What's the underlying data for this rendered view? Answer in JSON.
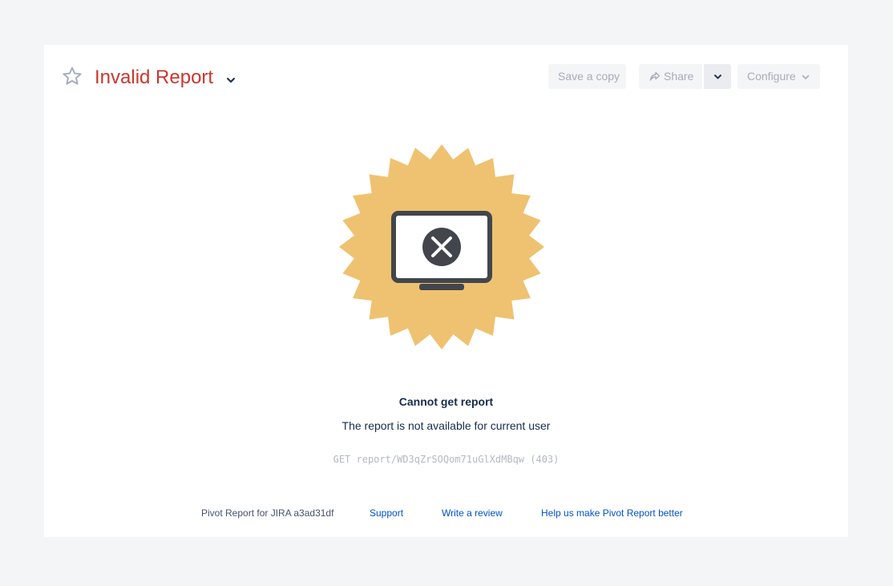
{
  "header": {
    "title": "Invalid Report",
    "save_label": "Save a copy",
    "share_label": "Share",
    "configure_label": "Configure"
  },
  "colors": {
    "title": "#c9372c",
    "badge": "#efc271",
    "monitor": "#42464c",
    "link": "#0052cc"
  },
  "icons": {
    "favorite": "star-icon",
    "title_menu": "chevron-down-icon",
    "share": "share-icon",
    "share_menu": "chevron-down-icon",
    "configure_menu": "chevron-down-icon",
    "illustration": "monitor-error-icon"
  },
  "message": {
    "title": "Cannot get report",
    "body": "The report is not available for current user",
    "request": "GET report/WD3qZrSOQom71uGlXdMBqw (403)"
  },
  "footer": {
    "version": "Pivot Report for JIRA a3ad31df",
    "support": "Support",
    "review": "Write a review",
    "feedback": "Help us make Pivot Report better"
  }
}
